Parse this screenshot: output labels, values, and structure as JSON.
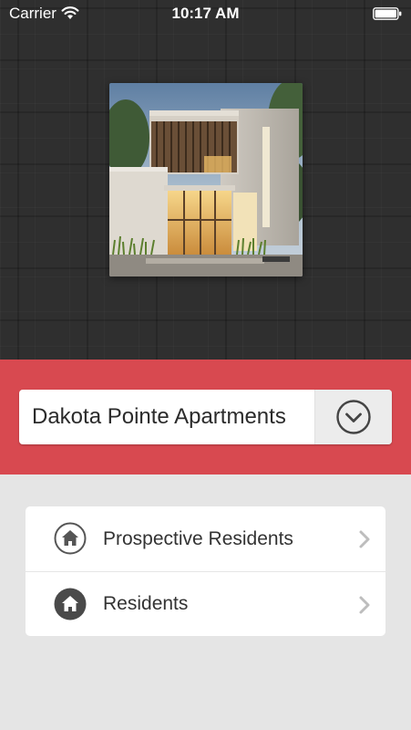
{
  "status_bar": {
    "carrier": "Carrier",
    "time": "10:17 AM",
    "wifi_icon": "wifi-icon",
    "battery_icon": "battery-icon"
  },
  "property": {
    "name": "Dakota Pointe Apartments",
    "dropdown_icon": "chevron-down-circle-icon"
  },
  "menu": {
    "items": [
      {
        "label": "Prospective Residents",
        "icon": "home-outline-icon"
      },
      {
        "label": "Residents",
        "icon": "home-filled-icon"
      }
    ],
    "chevron_icon": "chevron-right-icon"
  },
  "colors": {
    "accent_red": "#d84950",
    "header_dark": "#2f2f2f",
    "page_background": "#e5e5e5"
  }
}
